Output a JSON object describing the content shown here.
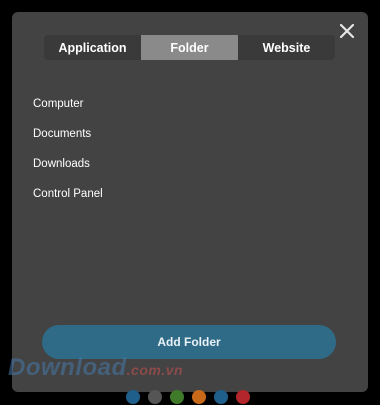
{
  "tabs": [
    {
      "label": "Application",
      "active": false
    },
    {
      "label": "Folder",
      "active": true
    },
    {
      "label": "Website",
      "active": false
    }
  ],
  "list": {
    "items": [
      "Computer",
      "Documents",
      "Downloads",
      "Control Panel"
    ]
  },
  "add_button": {
    "label": "Add Folder"
  },
  "close_icon": "close-icon",
  "watermark": {
    "main": "Download",
    "suffix": ".com.vn"
  },
  "colors": {
    "panel": "#434343",
    "active_tab": "#8a8a8a",
    "button": "#2f6b86",
    "dots": [
      "#1f5f8b",
      "#555555",
      "#3f7a2a",
      "#c8691a",
      "#1f5f8b",
      "#b3262b"
    ]
  }
}
